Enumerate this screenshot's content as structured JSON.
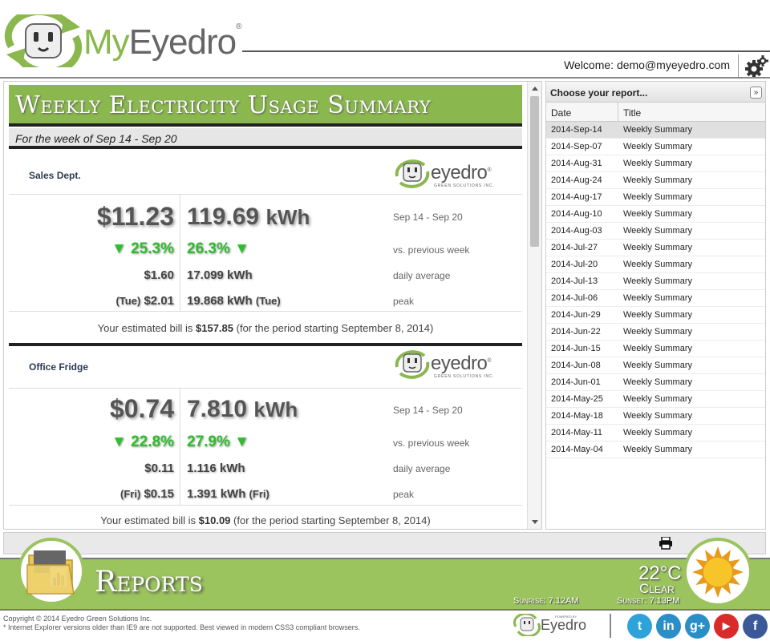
{
  "header": {
    "logo_my": "My",
    "logo_eyedro": "Eyedro",
    "logo_reg": "®",
    "welcome": "Welcome: demo@myeyedro.com"
  },
  "report": {
    "title": "Weekly Electricity Usage Summary",
    "week": "For the week of Sep 14 - Sep 20",
    "brand": "eyedro",
    "brand_reg": "®",
    "brand_sub": "GREEN SOLUTIONS INC.",
    "sections": [
      {
        "name": "Sales Dept.",
        "cost": "$11.23",
        "kwh_value": "119.69",
        "kwh_unit": "kWh",
        "range": "Sep 14 - Sep 20",
        "cost_change": "▼ 25.3%",
        "kwh_change": "26.3% ▼",
        "vs_label": "vs. previous week",
        "daily_cost": "$1.60",
        "daily_kwh": "17.099 kWh",
        "daily_label": "daily average",
        "peak_day": "(Tue)",
        "peak_cost": "$2.01",
        "peak_kwh": "19.868 kWh",
        "peak_kwh_day": "(Tue)",
        "peak_label": "peak",
        "bill_prefix": "Your estimated bill is ",
        "bill_amount": "$157.85",
        "bill_suffix": " (for the period starting September 8, 2014)"
      },
      {
        "name": "Office Fridge",
        "cost": "$0.74",
        "kwh_value": "7.810",
        "kwh_unit": "kWh",
        "range": "Sep 14 - Sep 20",
        "cost_change": "▼ 22.8%",
        "kwh_change": "27.9% ▼",
        "vs_label": "vs. previous week",
        "daily_cost": "$0.11",
        "daily_kwh": "1.116 kWh",
        "daily_label": "daily average",
        "peak_day": "(Fri)",
        "peak_cost": "$0.15",
        "peak_kwh": "1.391 kWh",
        "peak_kwh_day": "(Fri)",
        "peak_label": "peak",
        "bill_prefix": "Your estimated bill is ",
        "bill_amount": "$10.09",
        "bill_suffix": " (for the period starting September 8, 2014)"
      }
    ]
  },
  "sidebar": {
    "heading": "Choose your report...",
    "collapse_label": "»",
    "col_date": "Date",
    "col_title": "Title",
    "rows": [
      {
        "date": "2014-Sep-14",
        "title": "Weekly Summary"
      },
      {
        "date": "2014-Sep-07",
        "title": "Weekly Summary"
      },
      {
        "date": "2014-Aug-31",
        "title": "Weekly Summary"
      },
      {
        "date": "2014-Aug-24",
        "title": "Weekly Summary"
      },
      {
        "date": "2014-Aug-17",
        "title": "Weekly Summary"
      },
      {
        "date": "2014-Aug-10",
        "title": "Weekly Summary"
      },
      {
        "date": "2014-Aug-03",
        "title": "Weekly Summary"
      },
      {
        "date": "2014-Jul-27",
        "title": "Weekly Summary"
      },
      {
        "date": "2014-Jul-20",
        "title": "Weekly Summary"
      },
      {
        "date": "2014-Jul-13",
        "title": "Weekly Summary"
      },
      {
        "date": "2014-Jul-06",
        "title": "Weekly Summary"
      },
      {
        "date": "2014-Jun-29",
        "title": "Weekly Summary"
      },
      {
        "date": "2014-Jun-22",
        "title": "Weekly Summary"
      },
      {
        "date": "2014-Jun-15",
        "title": "Weekly Summary"
      },
      {
        "date": "2014-Jun-08",
        "title": "Weekly Summary"
      },
      {
        "date": "2014-Jun-01",
        "title": "Weekly Summary"
      },
      {
        "date": "2014-May-25",
        "title": "Weekly Summary"
      },
      {
        "date": "2014-May-18",
        "title": "Weekly Summary"
      },
      {
        "date": "2014-May-11",
        "title": "Weekly Summary"
      },
      {
        "date": "2014-May-04",
        "title": "Weekly Summary"
      }
    ]
  },
  "footer": {
    "reports_title": "Reports",
    "temperature": "22°C",
    "condition": "Clear",
    "sunrise": "Sunrise: 7:12AM",
    "sunset": "Sunset: 7:13PM",
    "copyright_line1": "Copyright © 2014 Eyedro Green Solutions Inc.",
    "copyright_line2": "* Internet Explorer versions older than IE9 are not supported. Best viewed in modern CSS3 compliant browsers.",
    "powered_by": "POWERED BY",
    "footer_brand": "Eyedro",
    "social": [
      {
        "icon": "twitter-icon",
        "glyph": "t",
        "color": "#2ea3d9"
      },
      {
        "icon": "linkedin-icon",
        "glyph": "in",
        "color": "#2a8ec7"
      },
      {
        "icon": "google-plus-icon",
        "glyph": "g+",
        "color": "#2a8ec7"
      },
      {
        "icon": "youtube-icon",
        "glyph": "▶",
        "color": "#d92b2b"
      },
      {
        "icon": "facebook-icon",
        "glyph": "f",
        "color": "#3b5998"
      }
    ]
  },
  "colors": {
    "brand_green": "#8ab74e",
    "footer_green": "#9bc35e",
    "change_green": "#2fbd2f"
  }
}
